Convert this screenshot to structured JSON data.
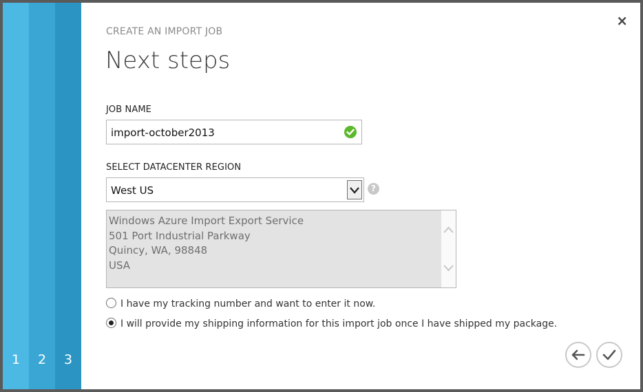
{
  "wizard": {
    "steps": [
      "1",
      "2",
      "3"
    ],
    "step_colors": [
      "#4cb8e4",
      "#3aa6d4",
      "#2b94c2"
    ],
    "close_label": "×"
  },
  "header": {
    "subtitle": "CREATE AN IMPORT JOB",
    "title": "Next steps"
  },
  "form": {
    "job_name_label": "JOB NAME",
    "job_name_value": "import-october2013",
    "region_label": "SELECT DATACENTER REGION",
    "region_value": "West US",
    "help_icon": "?",
    "address_lines": [
      "Windows Azure Import Export Service",
      "501 Port Industrial Parkway",
      "Quincy, WA, 98848",
      "USA"
    ],
    "options": [
      {
        "label": "I have my tracking number and want to enter it now.",
        "checked": false
      },
      {
        "label": "I will provide my shipping information for this import job once I have shipped my package.",
        "checked": true
      }
    ]
  },
  "footer": {
    "back_icon": "arrow-left-icon",
    "finish_icon": "checkmark-icon"
  },
  "colors": {
    "accent": "#4cb8e4",
    "valid": "#5db82d",
    "address_bg": "#e3e3e3"
  }
}
